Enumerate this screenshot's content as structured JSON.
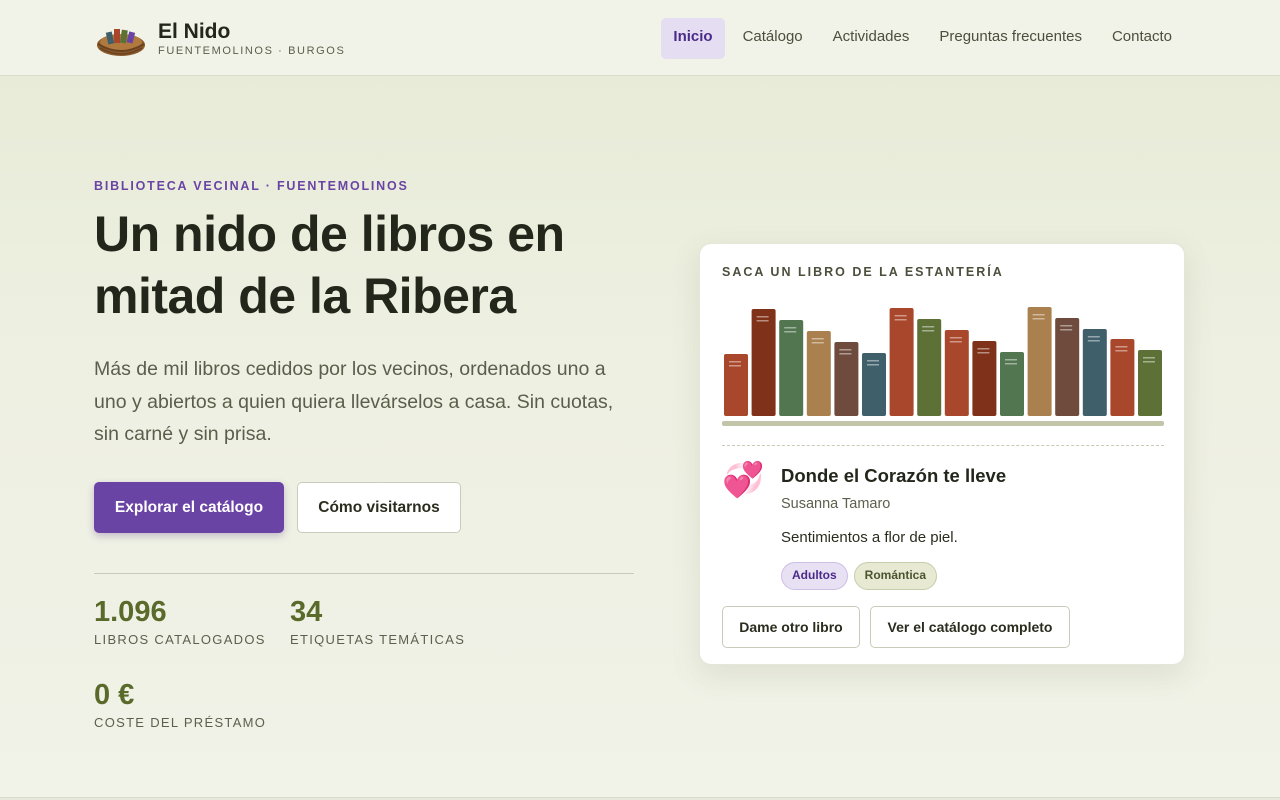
{
  "brand": {
    "name": "El Nido",
    "subtitle": "FUENTEMOLINOS · BURGOS",
    "logo_icon": "nest-icon"
  },
  "nav": {
    "items": [
      {
        "label": "Inicio",
        "active": true
      },
      {
        "label": "Catálogo",
        "active": false
      },
      {
        "label": "Actividades",
        "active": false
      },
      {
        "label": "Preguntas frecuentes",
        "active": false
      },
      {
        "label": "Contacto",
        "active": false
      }
    ]
  },
  "hero": {
    "eyebrow": "BIBLIOTECA VECINAL · FUENTEMOLINOS",
    "title": "Un nido de libros en mitad de la Ribera",
    "description": "Más de mil libros cedidos por los vecinos, ordenados uno a uno y abiertos a quien quiera llevárselos a casa. Sin cuotas, sin carné y sin prisa.",
    "primary_button": "Explorar el catálogo",
    "secondary_button": "Cómo visitarnos"
  },
  "stats": [
    {
      "value": "1.096",
      "label": "LIBROS CATALOGADOS"
    },
    {
      "value": "34",
      "label": "ETIQUETAS TEMÁTICAS"
    },
    {
      "value": "0 €",
      "label": "COSTE DEL PRÉSTAMO"
    }
  ],
  "card": {
    "title": "SACA UN LIBRO DE LA ESTANTERÍA",
    "shelf_colors": [
      "#a8472b",
      "#7f3219",
      "#527650",
      "#a9804e",
      "#6e4b3d",
      "#3f5f6a",
      "#a8472b",
      "#5d7137",
      "#a8472b",
      "#7f3219",
      "#527650",
      "#a9804e",
      "#6e4b3d",
      "#3f5f6a",
      "#a8472b",
      "#5d7137"
    ],
    "book": {
      "icon": "two-hearts-icon",
      "glyph": "💞",
      "title": "Donde el Corazón te lleve",
      "author": "Susanna Tamaro",
      "description": "Sentimientos a flor de piel.",
      "tags": [
        {
          "label": "Adultos",
          "style": "purple"
        },
        {
          "label": "Romántica",
          "style": "green"
        }
      ]
    },
    "buttons": {
      "another": "Dame otro libro",
      "full_catalog": "Ver el catálogo completo"
    }
  },
  "colors": {
    "accent": "#6a44a5",
    "stat_green": "#5a6a2a",
    "background": "#eef0e2"
  }
}
